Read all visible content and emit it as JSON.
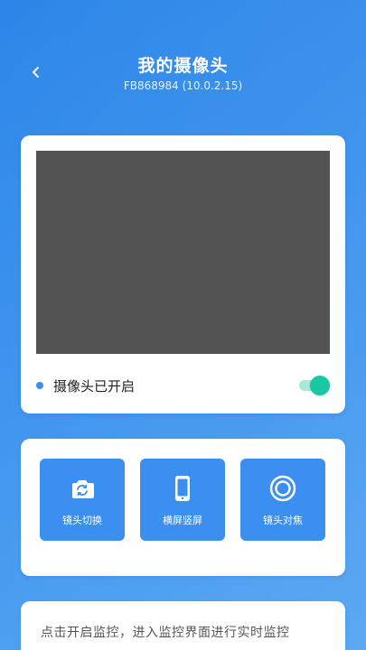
{
  "header": {
    "title": "我的摄像头",
    "subtitle": "FB868984 (10.0.2.15)"
  },
  "camera": {
    "status_text": "摄像头已开启",
    "toggle_on": true
  },
  "actions": [
    {
      "label": "镜头切换",
      "icon": "camera-switch-icon"
    },
    {
      "label": "横屏竖屏",
      "icon": "phone-rotate-icon"
    },
    {
      "label": "镜头对焦",
      "icon": "focus-icon"
    }
  ],
  "info": {
    "text": "点击开启监控，进入监控界面进行实时监控"
  },
  "colors": {
    "background": "#3a8ff0",
    "accent": "#3a8ff0",
    "toggle_on": "#19c8a3",
    "preview": "#535353"
  }
}
